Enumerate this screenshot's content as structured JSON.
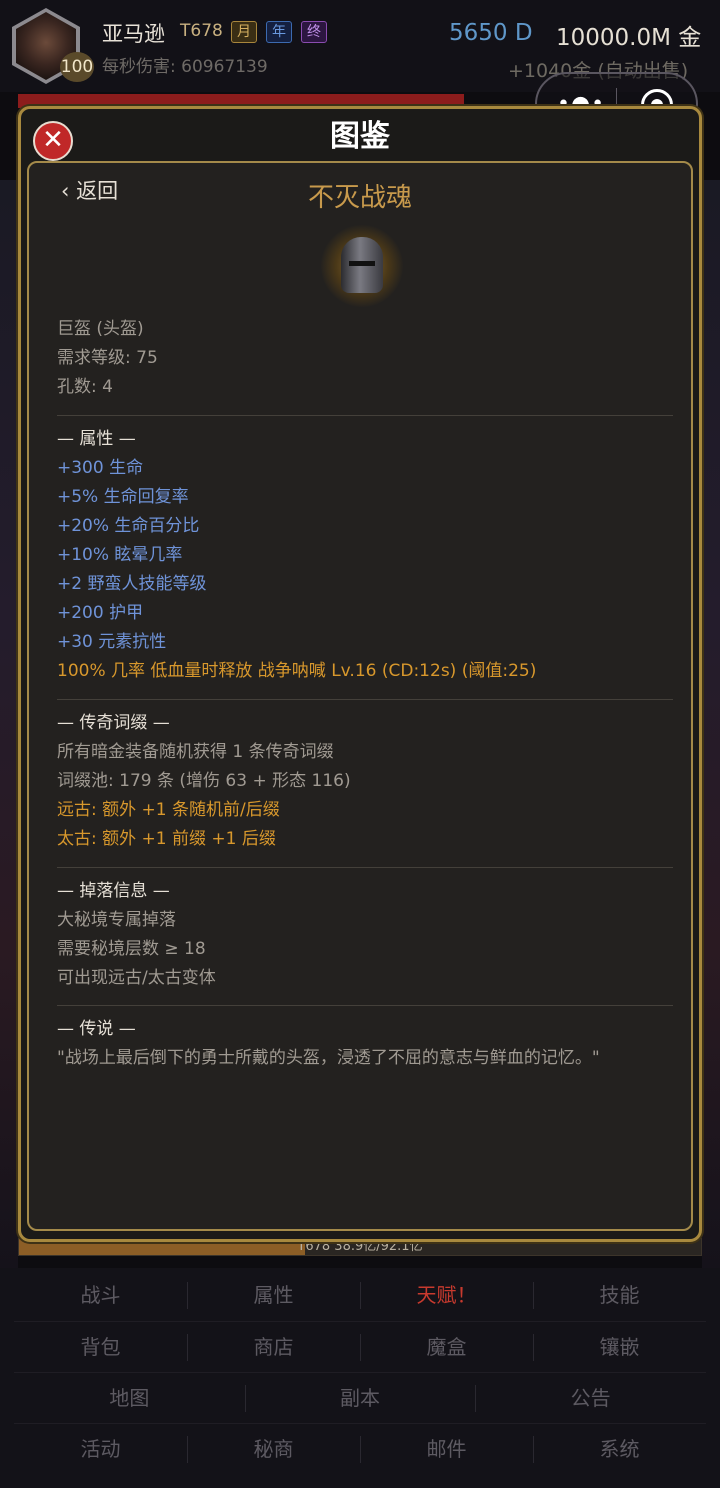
{
  "player": {
    "name": "亚马逊",
    "tier": "T678",
    "tags": [
      "月",
      "年",
      "终"
    ],
    "level": "100",
    "dps": "每秒伤害: 60967139",
    "diamonds": "5650 D",
    "gold": "10000.0M 金",
    "gold_sub": "+1040金 (自动出售)"
  },
  "dialog": {
    "title": "图鉴",
    "close_label": "✕",
    "back_label": "‹ 返回",
    "item_name": "不灭战魂",
    "item_icon": "helmet-icon",
    "basic": [
      "巨盔 (头盔)",
      "需求等级: 75",
      "孔数: 4"
    ],
    "attributes_header": "— 属性 —",
    "attributes": [
      "+300 生命",
      "+5% 生命回复率",
      "+20% 生命百分比",
      "+10% 眩晕几率",
      "+2 野蛮人技能等级",
      "+200 护甲",
      "+30 元素抗性"
    ],
    "proc": "100% 几率 低血量时释放 战争呐喊 Lv.16 (CD:12s) (阈值:25)",
    "legendary_header": "— 传奇词缀 —",
    "legendary": [
      "所有暗金装备随机获得 1 条传奇词缀",
      "词缀池: 179 条 (增伤 63 + 形态 116)"
    ],
    "legendary_variants": [
      "远古: 额外 +1 条随机前/后缀",
      "太古: 额外 +1 前缀 +1 后缀"
    ],
    "drop_header": "— 掉落信息 —",
    "drop": [
      "大秘境专属掉落",
      "需要秘境层数 ≥ 18",
      "可出现远古/太古变体"
    ],
    "lore_header": "— 传说 —",
    "lore": "\"战场上最后倒下的勇士所戴的头盔，浸透了不屈的意志与鲜血的记忆。\""
  },
  "progress": {
    "text": "T678  38.9亿/92.1亿",
    "fraction": 0.42
  },
  "nav": {
    "row1": [
      "战斗",
      "属性",
      "天赋！",
      "技能"
    ],
    "row2": [
      "背包",
      "商店",
      "魔盒",
      "镶嵌"
    ],
    "row3": [
      "地图",
      "副本",
      "公告"
    ],
    "row4": [
      "活动",
      "秘商",
      "邮件",
      "系统"
    ]
  },
  "colors": {
    "gold_border": "#a8893e",
    "attribute_blue": "#6f93d8",
    "highlight_orange": "#d8982c",
    "close_red": "#c02828",
    "alert_red": "#c83a2e"
  }
}
